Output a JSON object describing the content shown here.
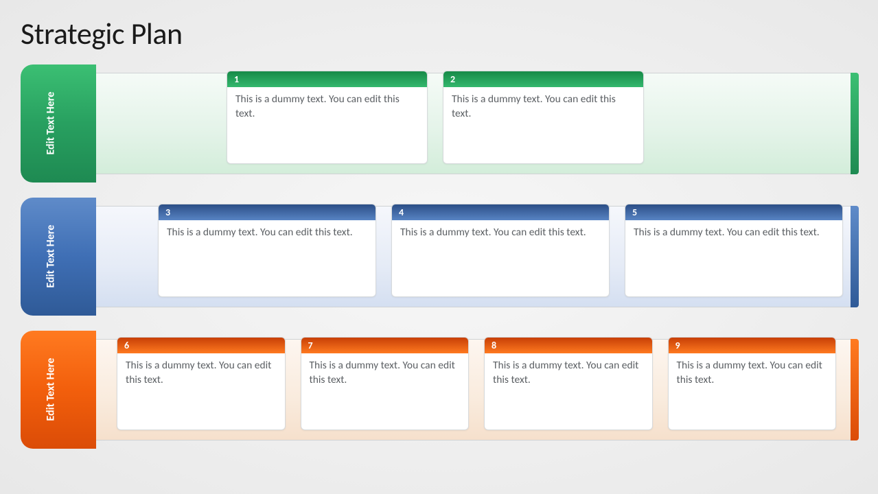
{
  "title": "Strategic Plan",
  "rows": [
    {
      "theme": "green",
      "tab": "Edit Text Here",
      "cards": [
        {
          "num": "1",
          "text": "This is a dummy text. You can edit this text."
        },
        {
          "num": "2",
          "text": "This is a dummy text. You can edit this text."
        }
      ]
    },
    {
      "theme": "blue",
      "tab": "Edit Text Here",
      "cards": [
        {
          "num": "3",
          "text": "This is a dummy text. You can edit this text."
        },
        {
          "num": "4",
          "text": "This is a dummy text. You can edit this text."
        },
        {
          "num": "5",
          "text": "This is a dummy text. You can edit this text."
        }
      ]
    },
    {
      "theme": "orange",
      "tab": "Edit Text Here",
      "cards": [
        {
          "num": "6",
          "text": "This is a dummy text. You can edit this text."
        },
        {
          "num": "7",
          "text": "This is a dummy text. You can edit this text."
        },
        {
          "num": "8",
          "text": "This is a dummy text. You can edit this text."
        },
        {
          "num": "9",
          "text": "This is a dummy text. You can edit this text."
        }
      ]
    }
  ]
}
